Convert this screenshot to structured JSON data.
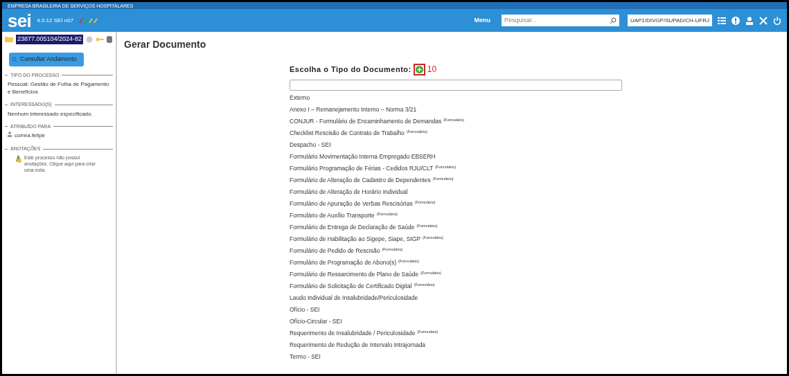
{
  "header": {
    "org": "EMPRESA BRASILEIRA DE SERVIÇOS HOSPITALARES",
    "logo": "sei",
    "version": "4.0.12 SEI n07",
    "menu": "Menu",
    "search": {
      "placeholder": "Pesquisar..."
    },
    "unit": "UAP1/DIVGP/SUPAD/CH-UFRJ"
  },
  "sidebar": {
    "process": "23877.005104/2024-82",
    "button": "Consultar Andamento",
    "sections": [
      {
        "kind": "text",
        "title": "TIPO DO PROCESSO",
        "text": "Pessoal: Gestão de Folha de Pagamento e Benefícios"
      },
      {
        "kind": "text",
        "title": "INTERESSADO(S)",
        "text": "Nenhum interessado especificado."
      },
      {
        "kind": "user",
        "title": "ATRIBUÍDO PARA",
        "text": "correa.felipe"
      },
      {
        "kind": "note",
        "title": "ANOTAÇÕES",
        "text": "Este processo não possui anotações. Clique aqui para criar uma nota."
      }
    ]
  },
  "page": {
    "title": "Gerar Documento",
    "prompt": "Escolha o Tipo do Documento:",
    "annotation": "10",
    "types": [
      "Externo",
      "Anexo I – Remanejamento Interno – Norma 3/21",
      "CONJUR - Formulário de Encaminhamento de Demandas $^{(Formulário)}$",
      "Checklist Rescisão de Contrato de Trabalho $^{(Formulário)}$",
      "Despacho - SEI",
      "Formulário Movimentação Interna Empregado EBSERH",
      "Formulário Programação de Férias - Cedidos RJU/CLT $^{(Formulário)}$",
      "Formulário de Alteração de Cadastro de Dependentes $^{(Formulário)}$",
      "Formulário de Alteração de Horário Individual",
      "Formulário de Apuração de Verbas Rescisórias $^{(Formulário)}$",
      "Formulário de Auxílio Transporte $^{(Formulário)}$",
      "Formulário de Entrega de Declaração de Saúde $^{(Formulário)}$",
      "Formulário de Habilitação ao Sigepe, Siape, SIGP $^{(Formulário)}$",
      "Formulário de Pedido de Rescisão $^{(Formulário)}$",
      "Formulário de Programação de Abono(s) $^{(Formulário)}$",
      "Formulário de Ressarcimento de Plano de Saúde $^{(Formulário)}$",
      "Formulário de Solicitação de Certificado Digital $^{(Formulário)}$",
      "Laudo Individual de Insalubridade/Periculosidade",
      "Ofício - SEI",
      "Ofício-Circular - SEI",
      "Requerimento de Insalubridade / Periculosidade $^{(Formulário)}$",
      "Requerimento de Redução de Intervalo Intrajornada",
      "Termo - SEI"
    ]
  }
}
